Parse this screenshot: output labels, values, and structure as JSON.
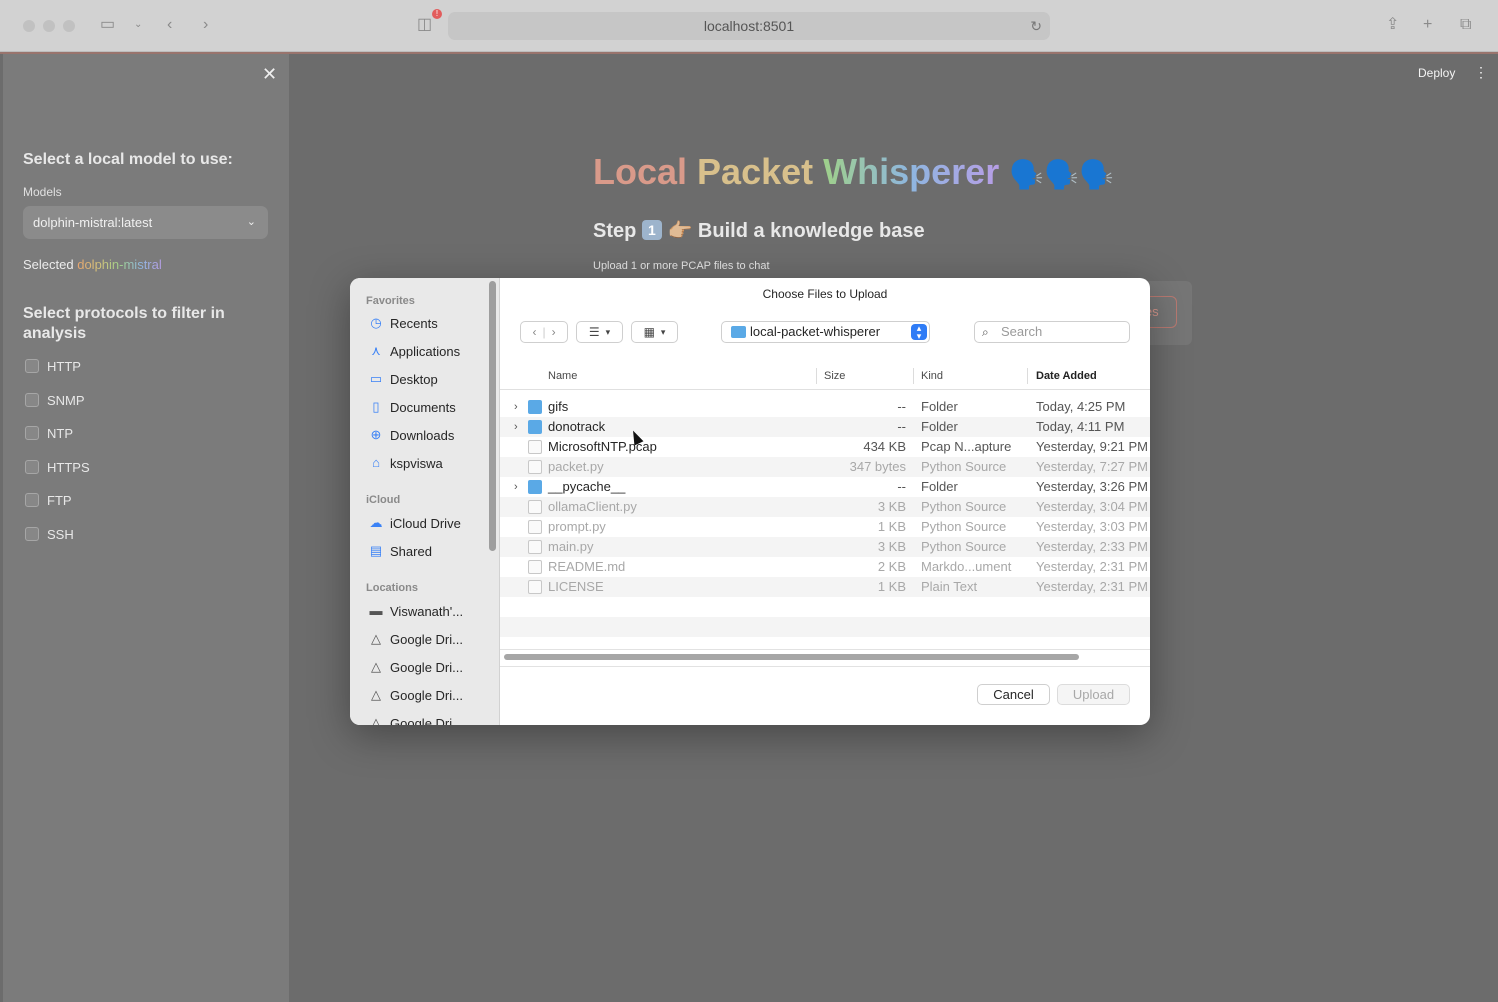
{
  "browser": {
    "url": "localhost:8501",
    "badge": "!"
  },
  "app": {
    "deploy_label": "Deploy",
    "title_parts": [
      "Local",
      "Packet",
      "Whisperer"
    ],
    "title_emoji": "🗣️🗣️🗣️",
    "step_prefix": "Step",
    "step_number": "1",
    "step_title": "👉🏼 Build a knowledge base",
    "upload_hint": "Upload 1 or more PCAP files to chat",
    "browse_fragment": "les"
  },
  "sidebar": {
    "model_heading": "Select a local model to use:",
    "models_label": "Models",
    "model_value": "dolphin-mistral:latest",
    "selected_prefix": "Selected",
    "selected_model": "dolphin-mistral",
    "protocols_heading": "Select protocols to filter in analysis",
    "protocols": [
      "HTTP",
      "SNMP",
      "NTP",
      "HTTPS",
      "FTP",
      "SSH"
    ]
  },
  "dialog": {
    "title": "Choose Files to Upload",
    "favorites_heading": "Favorites",
    "favorites": [
      {
        "label": "Recents",
        "icon": "clock-icon"
      },
      {
        "label": "Applications",
        "icon": "apps-icon"
      },
      {
        "label": "Desktop",
        "icon": "desktop-icon"
      },
      {
        "label": "Documents",
        "icon": "document-icon"
      },
      {
        "label": "Downloads",
        "icon": "download-icon"
      },
      {
        "label": "kspviswa",
        "icon": "home-icon"
      }
    ],
    "icloud_heading": "iCloud",
    "icloud": [
      {
        "label": "iCloud Drive",
        "icon": "cloud-icon"
      },
      {
        "label": "Shared",
        "icon": "shared-folder-icon"
      }
    ],
    "locations_heading": "Locations",
    "locations": [
      {
        "label": "Viswanath'...",
        "icon": "laptop-icon"
      },
      {
        "label": "Google Dri...",
        "icon": "drive-icon"
      },
      {
        "label": "Google Dri...",
        "icon": "drive-icon"
      },
      {
        "label": "Google Dri...",
        "icon": "drive-icon"
      },
      {
        "label": "Google Dri...",
        "icon": "drive-icon"
      }
    ],
    "current_folder": "local-packet-whisperer",
    "search_placeholder": "Search",
    "columns": {
      "name": "Name",
      "size": "Size",
      "kind": "Kind",
      "date": "Date Added"
    },
    "files": [
      {
        "name": "gifs",
        "size": "--",
        "kind": "Folder",
        "date": "Today, 4:25 PM",
        "type": "folder",
        "enabled": true
      },
      {
        "name": "donotrack",
        "size": "--",
        "kind": "Folder",
        "date": "Today, 4:11 PM",
        "type": "folder",
        "enabled": true
      },
      {
        "name": "MicrosoftNTP.pcap",
        "size": "434 KB",
        "kind": "Pcap N...apture",
        "date": "Yesterday, 9:21 PM",
        "type": "doc",
        "enabled": true
      },
      {
        "name": "packet.py",
        "size": "347 bytes",
        "kind": "Python Source",
        "date": "Yesterday, 7:27 PM",
        "type": "doc",
        "enabled": false
      },
      {
        "name": "__pycache__",
        "size": "--",
        "kind": "Folder",
        "date": "Yesterday, 3:26 PM",
        "type": "folder",
        "enabled": true
      },
      {
        "name": "ollamaClient.py",
        "size": "3 KB",
        "kind": "Python Source",
        "date": "Yesterday, 3:04 PM",
        "type": "doc",
        "enabled": false
      },
      {
        "name": "prompt.py",
        "size": "1 KB",
        "kind": "Python Source",
        "date": "Yesterday, 3:03 PM",
        "type": "doc",
        "enabled": false
      },
      {
        "name": "main.py",
        "size": "3 KB",
        "kind": "Python Source",
        "date": "Yesterday, 2:33 PM",
        "type": "doc",
        "enabled": false
      },
      {
        "name": "README.md",
        "size": "2 KB",
        "kind": "Markdo...ument",
        "date": "Yesterday, 2:31 PM",
        "type": "doc",
        "enabled": false
      },
      {
        "name": "LICENSE",
        "size": "1 KB",
        "kind": "Plain Text",
        "date": "Yesterday, 2:31 PM",
        "type": "doc",
        "enabled": false
      }
    ],
    "cancel_label": "Cancel",
    "upload_label": "Upload"
  }
}
